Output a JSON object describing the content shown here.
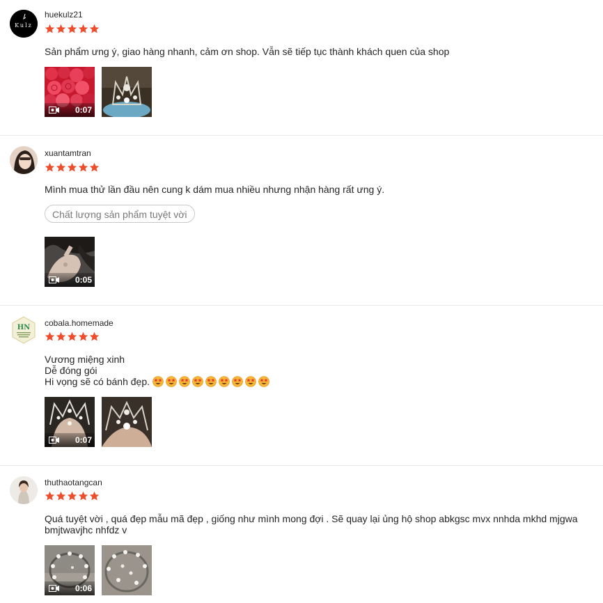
{
  "colors": {
    "star": "#ee4d2d",
    "divider": "#e8e8e8"
  },
  "reviews": [
    {
      "username": "huekulz21",
      "rating": 5,
      "avatar_text": "Kulz",
      "comment_lines": [
        "Sản phẩm ưng ý, giao hàng nhanh, cảm ơn shop. Vẫn sẽ tiếp tục thành khách quen của shop"
      ],
      "media": [
        {
          "type": "video",
          "duration": "0:07",
          "subject": "red-roses"
        },
        {
          "type": "image",
          "subject": "crown"
        }
      ]
    },
    {
      "username": "xuantamtran",
      "rating": 5,
      "comment_lines": [
        "Mình mua thử lần đầu nên cung k dám mua nhiều nhưng nhận hàng rất ưng ý."
      ],
      "tag": "Chất lượng sản phẩm tuyệt vời",
      "media": [
        {
          "type": "video",
          "duration": "0:05",
          "subject": "hand-with-hair"
        }
      ]
    },
    {
      "username": "cobala.homemade",
      "rating": 5,
      "avatar_text": "HN",
      "comment_lines": [
        "Vương miệng xinh",
        "Dễ đóng gói",
        "Hi vọng sẽ có bánh đẹp."
      ],
      "emoji_count": 9,
      "emoji_name": "star-struck-emoji",
      "media": [
        {
          "type": "video",
          "duration": "0:07",
          "subject": "crown-on-hand"
        },
        {
          "type": "image",
          "subject": "crown-closeup"
        }
      ]
    },
    {
      "username": "thuthaotangcan",
      "rating": 5,
      "comment_lines": [
        "Quá tuyệt vời , quá đẹp mẫu mã đẹp , giống như mình mong đợi . Sẽ quay lại ủng hộ shop abkgsc mvx nnhda mkhd mjgwa",
        "bmjtwavjhc nhfdz v"
      ],
      "media": [
        {
          "type": "video",
          "duration": "0:06",
          "subject": "pearl-headband"
        },
        {
          "type": "image",
          "subject": "pearl-headband"
        }
      ]
    }
  ]
}
